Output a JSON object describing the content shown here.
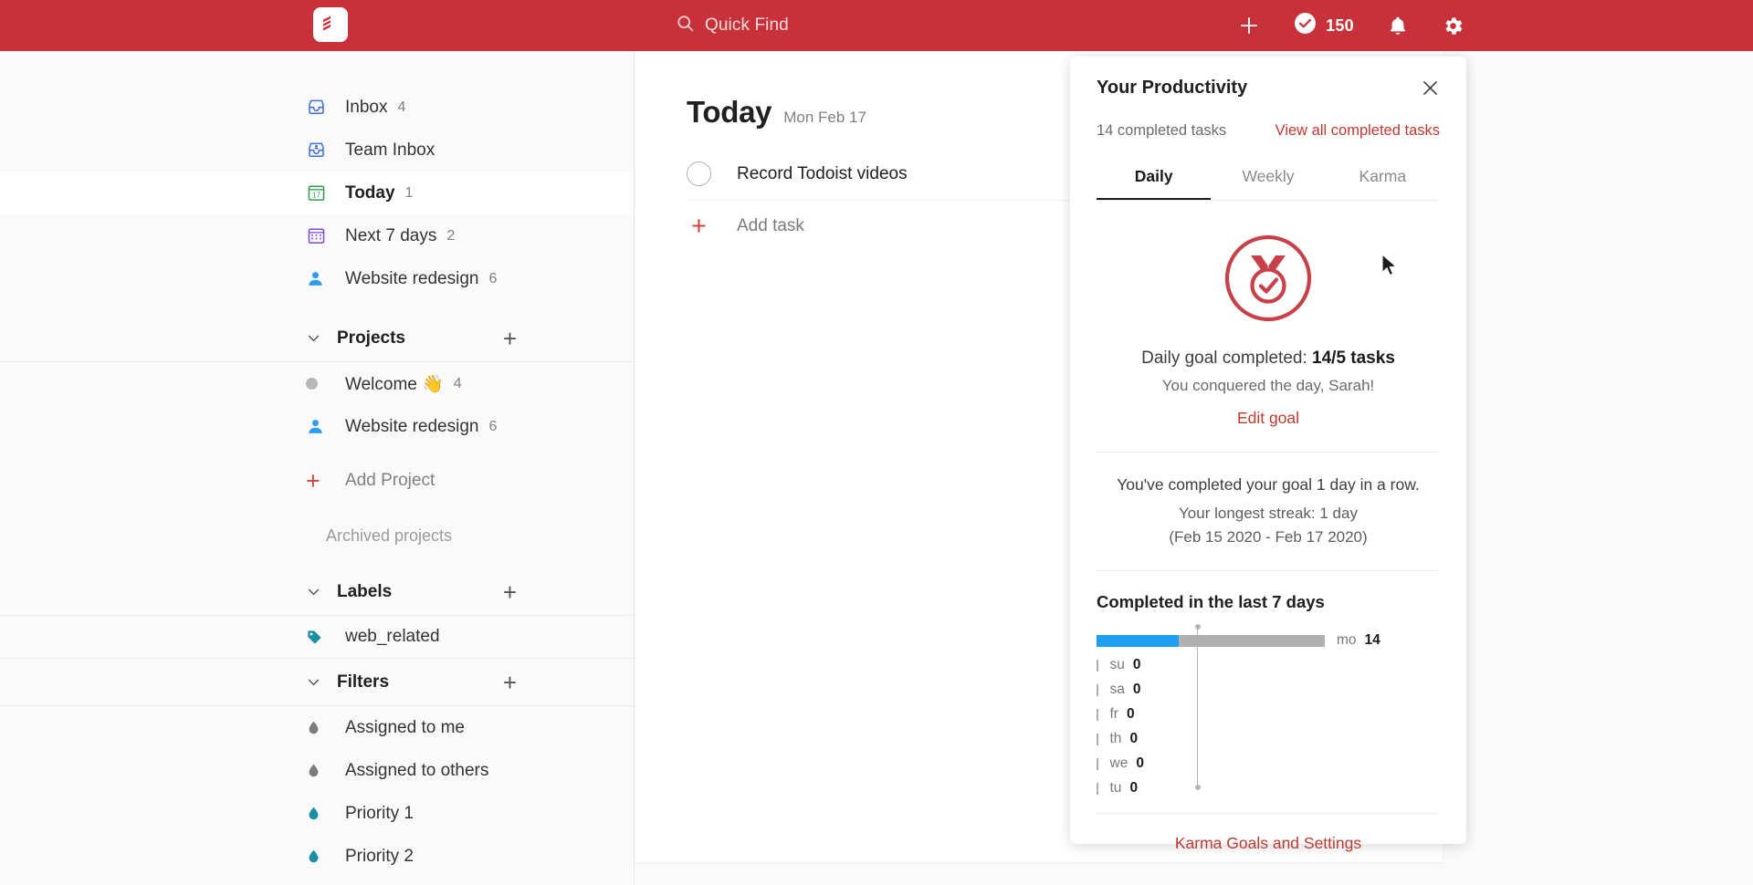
{
  "theme": {
    "header_red": "#c8313a",
    "accent_red": "#d1453b",
    "link_red": "#c0392f",
    "bar_blue": "#1f9ff0",
    "bar_gray": "#b0b0b0"
  },
  "topbar": {
    "logo_icon": "todoist-logo-icon",
    "search_icon": "search-icon",
    "search_placeholder": "Quick Find",
    "add_icon": "plus-icon",
    "karma_icon": "check-circle-icon",
    "karma_points": "150",
    "notifications_icon": "bell-icon",
    "settings_icon": "gear-icon"
  },
  "sidebar": {
    "nav": [
      {
        "icon": "inbox-icon",
        "label": "Inbox",
        "count": "4"
      },
      {
        "icon": "team-inbox-icon",
        "label": "Team Inbox",
        "count": ""
      },
      {
        "icon": "calendar-17-icon",
        "label": "Today",
        "count": "1",
        "active": true
      },
      {
        "icon": "calendar-grid-icon",
        "label": "Next 7 days",
        "count": "2"
      },
      {
        "icon": "person-icon",
        "label": "Website redesign",
        "count": "6"
      }
    ],
    "projects_section": {
      "title": "Projects",
      "chevron_icon": "chevron-down-icon",
      "add_icon": "plus-icon",
      "items": [
        {
          "icon": "dot-icon",
          "label": "Welcome 👋",
          "count": "4"
        },
        {
          "icon": "person-icon",
          "label": "Website redesign",
          "count": "6"
        }
      ],
      "add_project_label": "Add Project",
      "archived_label": "Archived projects"
    },
    "labels_section": {
      "title": "Labels",
      "chevron_icon": "chevron-down-icon",
      "add_icon": "plus-icon",
      "items": [
        {
          "icon": "tag-icon",
          "label": "web_related"
        }
      ]
    },
    "filters_section": {
      "title": "Filters",
      "chevron_icon": "chevron-down-icon",
      "add_icon": "plus-icon",
      "items": [
        {
          "icon": "drop-icon",
          "label": "Assigned to me",
          "color": "#7c7c7c"
        },
        {
          "icon": "drop-icon",
          "label": "Assigned to others",
          "color": "#7c7c7c"
        },
        {
          "icon": "drop-icon",
          "label": "Priority 1",
          "color": "#1a8fa3"
        },
        {
          "icon": "drop-icon",
          "label": "Priority 2",
          "color": "#1a8fa3"
        }
      ]
    }
  },
  "main": {
    "title": "Today",
    "date": "Mon Feb 17",
    "tasks": [
      {
        "checkbox_icon": "task-checkbox-icon",
        "name": "Record Todoist videos"
      }
    ],
    "add_task_label": "Add task",
    "add_task_icon": "plus-icon"
  },
  "panel": {
    "title": "Your Productivity",
    "close_icon": "close-icon",
    "completed_summary": "14 completed tasks",
    "view_all_link": "View all completed tasks",
    "tabs": [
      {
        "label": "Daily",
        "active": true
      },
      {
        "label": "Weekly",
        "active": false
      },
      {
        "label": "Karma",
        "active": false
      }
    ],
    "medal_icon": "medal-check-icon",
    "goal_prefix": "Daily goal completed: ",
    "goal_value": "14/5 tasks",
    "goal_message": "You conquered the day, Sarah!",
    "edit_goal_label": "Edit goal",
    "streak_current": "You've completed your goal 1 day in a row.",
    "streak_longest": "Your longest streak: 1 day",
    "streak_range": "(Feb 15 2020 - Feb 17 2020)",
    "karma_settings_link": "Karma Goals and Settings"
  },
  "chart_data": {
    "type": "bar",
    "title": "Completed in the last 7 days",
    "orientation": "horizontal",
    "categories": [
      "mo",
      "su",
      "sa",
      "fr",
      "th",
      "we",
      "tu"
    ],
    "values": [
      14,
      0,
      0,
      0,
      0,
      0,
      0
    ],
    "goal_value": 5,
    "max_value": 14,
    "bar_color": "#b0b0b0",
    "goal_fill_color": "#1f9ff0",
    "goal_marker_label": "daily goal line",
    "xlabel": "",
    "ylabel": "",
    "grid": false,
    "legend": false
  },
  "cursor": {
    "icon": "mouse-pointer-icon",
    "x": "1513",
    "y": "278"
  }
}
